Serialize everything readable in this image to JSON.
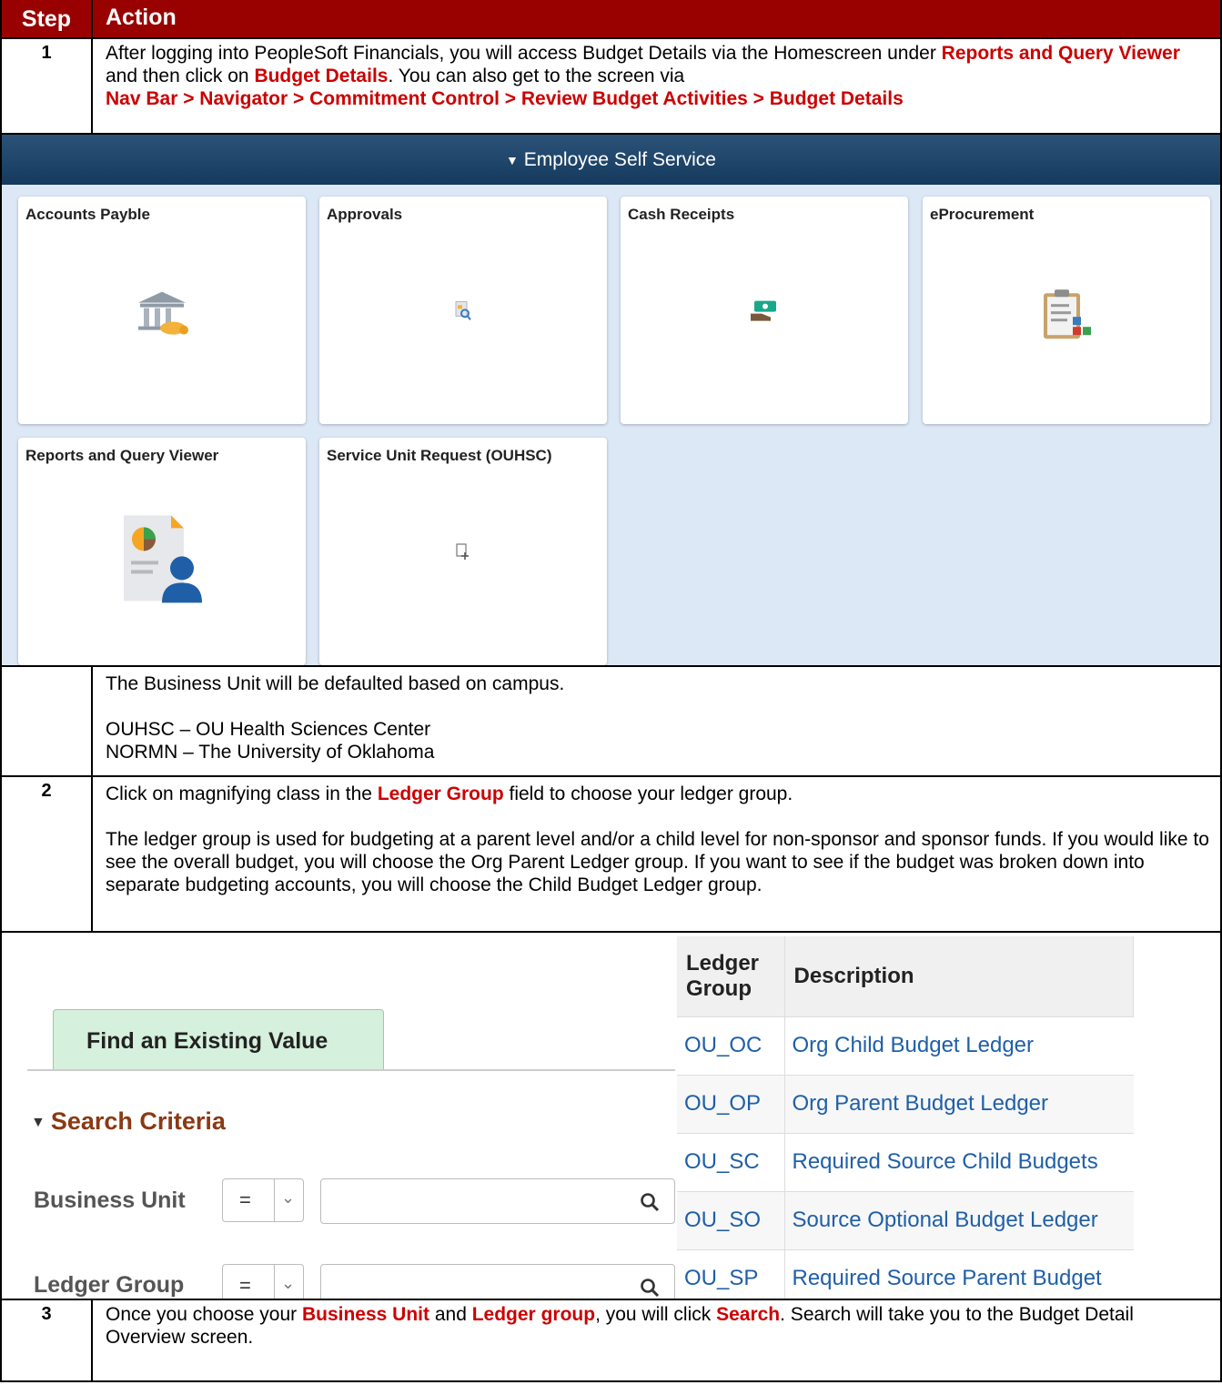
{
  "header": {
    "step": "Step",
    "action": "Action"
  },
  "step1": {
    "num": "1",
    "t1": "After logging into PeopleSoft Financials, you will access Budget Details via the Homescreen under ",
    "b1": "Reports and Query Viewer",
    "t2": " and then click on ",
    "b2": "Budget Details",
    "t3": ".  You can also get to the screen via ",
    "path": "Nav Bar > Navigator > Commitment Control > Review Budget Activities > Budget Details"
  },
  "homepage": {
    "banner": "Employee Self Service",
    "tiles": [
      {
        "title": "Accounts Payble",
        "icon": "bank-icon"
      },
      {
        "title": "Approvals",
        "icon": "document-search-icon"
      },
      {
        "title": "Cash Receipts",
        "icon": "cash-hand-icon"
      },
      {
        "title": "eProcurement",
        "icon": "clipboard-icon"
      },
      {
        "title": "Reports and Query Viewer",
        "icon": "report-user-icon"
      },
      {
        "title": "Service Unit Request (OUHSC)",
        "icon": "document-add-icon"
      }
    ]
  },
  "bu_note": {
    "line1": "The Business Unit will be defaulted based on campus.",
    "line2": "OUHSC – OU Health Sciences Center",
    "line3": "NORMN – The University of Oklahoma"
  },
  "step2": {
    "num": "2",
    "t1": "Click on magnifying class in the ",
    "b1": "Ledger Group",
    "t2": " field to choose your ledger group.",
    "para": "The ledger group is used for budgeting at a parent level and/or a child level for non-sponsor and sponsor funds.  If you would like to see the overall budget, you will choose the Org Parent Ledger group.  If you want to see if the budget was broken down into separate budgeting accounts, you will choose the Child Budget Ledger group."
  },
  "search": {
    "tab": "Find an Existing Value",
    "criteria": "Search Criteria",
    "fields": [
      {
        "label": "Business Unit",
        "op": "=",
        "value": ""
      },
      {
        "label": "Ledger Group",
        "op": "=",
        "value": ""
      }
    ]
  },
  "ledger_table": {
    "col1": "Ledger Group",
    "col2": "Description",
    "rows": [
      {
        "code": "OU_OC",
        "desc": "Org Child Budget Ledger"
      },
      {
        "code": "OU_OP",
        "desc": "Org Parent Budget Ledger"
      },
      {
        "code": "OU_SC",
        "desc": "Required Source Child Budgets"
      },
      {
        "code": "OU_SO",
        "desc": "Source Optional Budget Ledger"
      },
      {
        "code": "OU_SP",
        "desc": "Required Source Parent Budget"
      }
    ]
  },
  "step3": {
    "num": "3",
    "t1": "Once you choose your ",
    "b1": "Business Unit",
    "t2": " and ",
    "b2": "Ledger group",
    "t3": ", you will click ",
    "b3": "Search",
    "t4": ".  Search will take you to the Budget Detail Overview screen."
  }
}
